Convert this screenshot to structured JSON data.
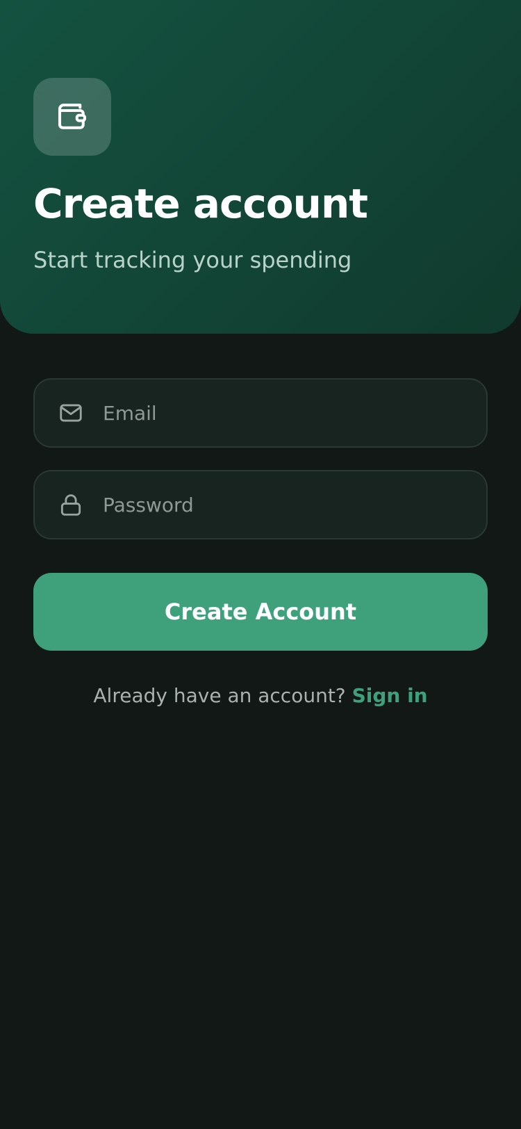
{
  "header": {
    "title": "Create account",
    "subtitle": "Start tracking your spending",
    "logo_icon": "wallet-icon"
  },
  "form": {
    "email": {
      "placeholder": "Email",
      "value": "",
      "icon": "mail-icon"
    },
    "password": {
      "placeholder": "Password",
      "value": "",
      "icon": "lock-icon"
    },
    "submit_label": "Create Account"
  },
  "footer": {
    "prompt": "Already have an account?",
    "link_label": "Sign in"
  },
  "colors": {
    "accent": "#3fa07c",
    "header_gradient_start": "#145240",
    "header_gradient_end": "#103a2d",
    "background": "#111816",
    "input_background": "#18241f"
  }
}
